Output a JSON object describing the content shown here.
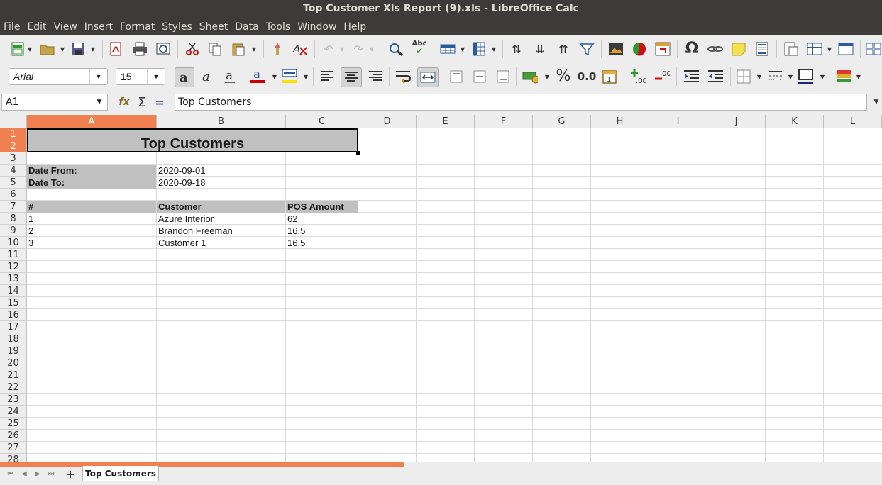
{
  "window": {
    "title": "Top Customer Xls Report (9).xls - LibreOffice Calc"
  },
  "menu": [
    "File",
    "Edit",
    "View",
    "Insert",
    "Format",
    "Styles",
    "Sheet",
    "Data",
    "Tools",
    "Window",
    "Help"
  ],
  "toolbar": {
    "font_name": "Arial",
    "font_size": "15",
    "percent_label": "%",
    "number_format_label": "0.0",
    "omega_label": "Ω",
    "abc_label": "Abc"
  },
  "formula_bar": {
    "cell_ref": "A1",
    "func_label": "fx",
    "sum_label": "Σ",
    "equals_label": "=",
    "content": "Top Customers"
  },
  "columns": [
    "A",
    "B",
    "C",
    "D",
    "E",
    "F",
    "G",
    "H",
    "I",
    "J",
    "K",
    "L"
  ],
  "rows": [
    "1",
    "2",
    "3",
    "4",
    "5",
    "6",
    "7",
    "8",
    "9",
    "10",
    "11",
    "12",
    "13",
    "14",
    "15",
    "16",
    "17",
    "18",
    "19",
    "20",
    "21",
    "22",
    "23",
    "24",
    "25",
    "26",
    "27",
    "28"
  ],
  "sheet": {
    "title": "Top Customers",
    "date_from_label": "Date From:",
    "date_from": "2020-09-01",
    "date_to_label": "Date To:",
    "date_to": "2020-09-18",
    "headers": [
      "#",
      "Customer",
      "POS Amount"
    ],
    "data": [
      [
        "1",
        "Azure Interior",
        "62"
      ],
      [
        "2",
        "Brandon Freeman",
        "16.5"
      ],
      [
        "3",
        "Customer 1",
        "16.5"
      ]
    ]
  },
  "tabs": {
    "active": "Top Customers",
    "add_label": "+"
  }
}
